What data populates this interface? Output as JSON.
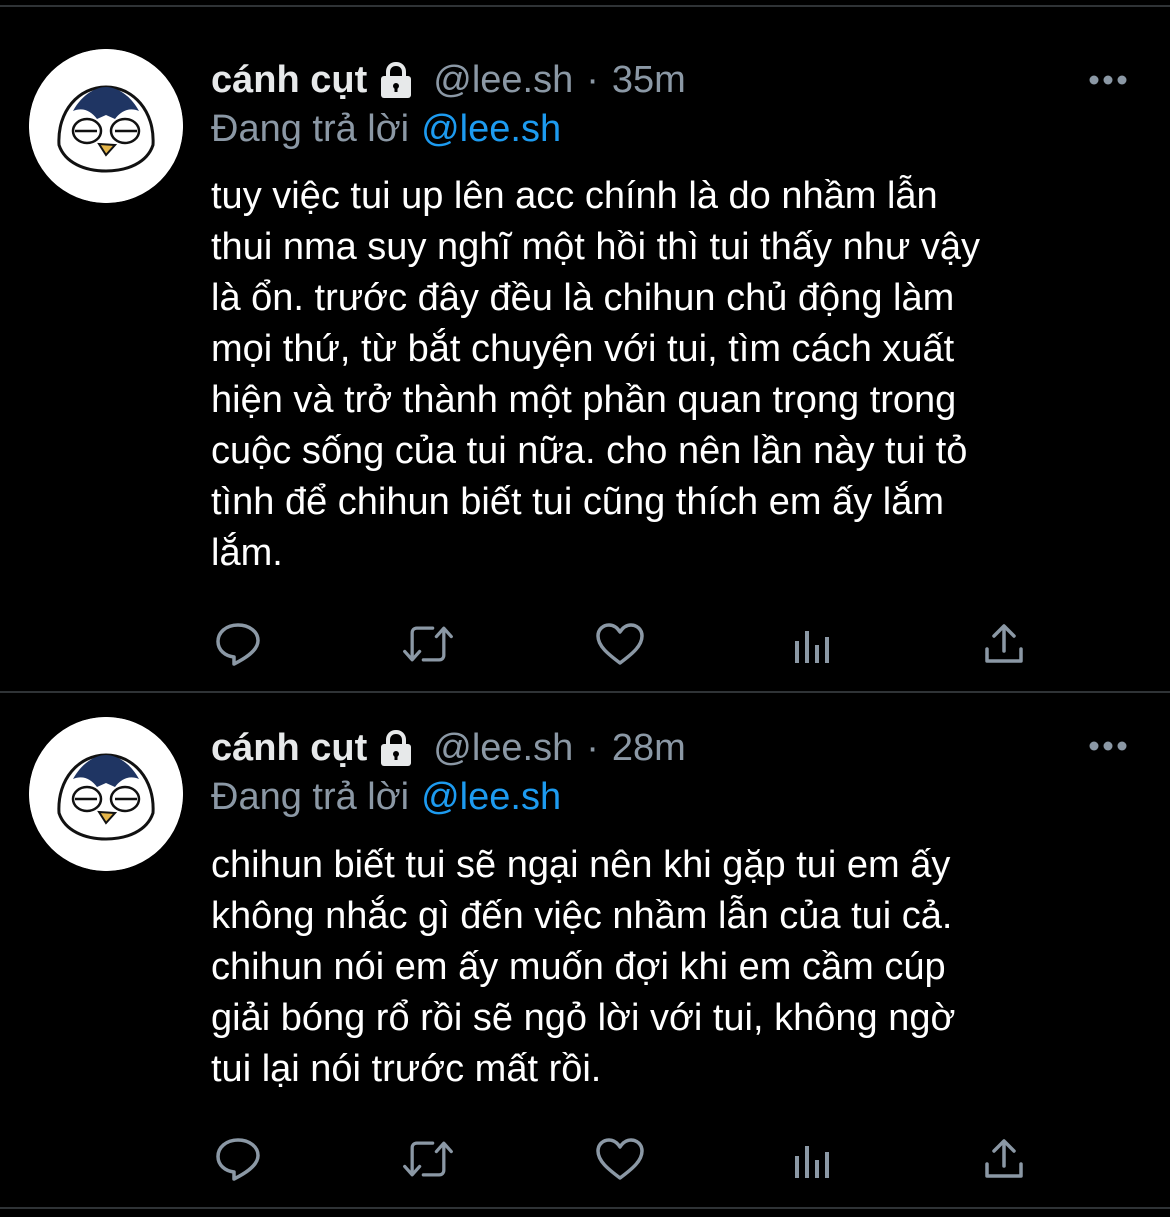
{
  "colors": {
    "background": "#000000",
    "text_primary": "#ffffff",
    "text_secondary": "#8b98a5",
    "accent": "#1d9bf0",
    "divider": "#2f3336",
    "icon": "#8b98a5"
  },
  "tweets": [
    {
      "display_name": "cánh cụt",
      "lock_icon": "lock-icon",
      "handle": "@lee.sh",
      "separator": "·",
      "time": "35m",
      "reply_prefix": "Đang trả lời",
      "reply_to": "@lee.sh",
      "text": "tuy việc tui up lên acc chính là do nhầm lẫn\nthui nma suy nghĩ một hồi thì tui thấy như vậy\nlà ổn. trước đây đều là chihun chủ động làm\nmọi thứ, từ bắt chuyện với tui, tìm cách xuất\nhiện và trở thành một phần quan trọng trong\ncuộc sống của tui nữa. cho nên lần này tui tỏ\ntình để chihun biết tui cũng thích em ấy lắm\nlắm.",
      "actions": [
        "reply-icon",
        "retweet-icon",
        "like-icon",
        "analytics-icon",
        "share-icon"
      ]
    },
    {
      "display_name": "cánh cụt",
      "lock_icon": "lock-icon",
      "handle": "@lee.sh",
      "separator": "·",
      "time": "28m",
      "reply_prefix": "Đang trả lời",
      "reply_to": "@lee.sh",
      "text": "chihun biết tui sẽ ngại nên khi gặp tui em ấy\nkhông nhắc gì đến việc nhầm lẫn của tui cả.\nchihun nói em ấy muốn đợi khi em cầm cúp\ngiải bóng rổ rồi sẽ ngỏ lời với tui, không ngờ\ntui lại nói trước mất rồi.",
      "actions": [
        "reply-icon",
        "retweet-icon",
        "like-icon",
        "analytics-icon",
        "share-icon"
      ]
    }
  ]
}
